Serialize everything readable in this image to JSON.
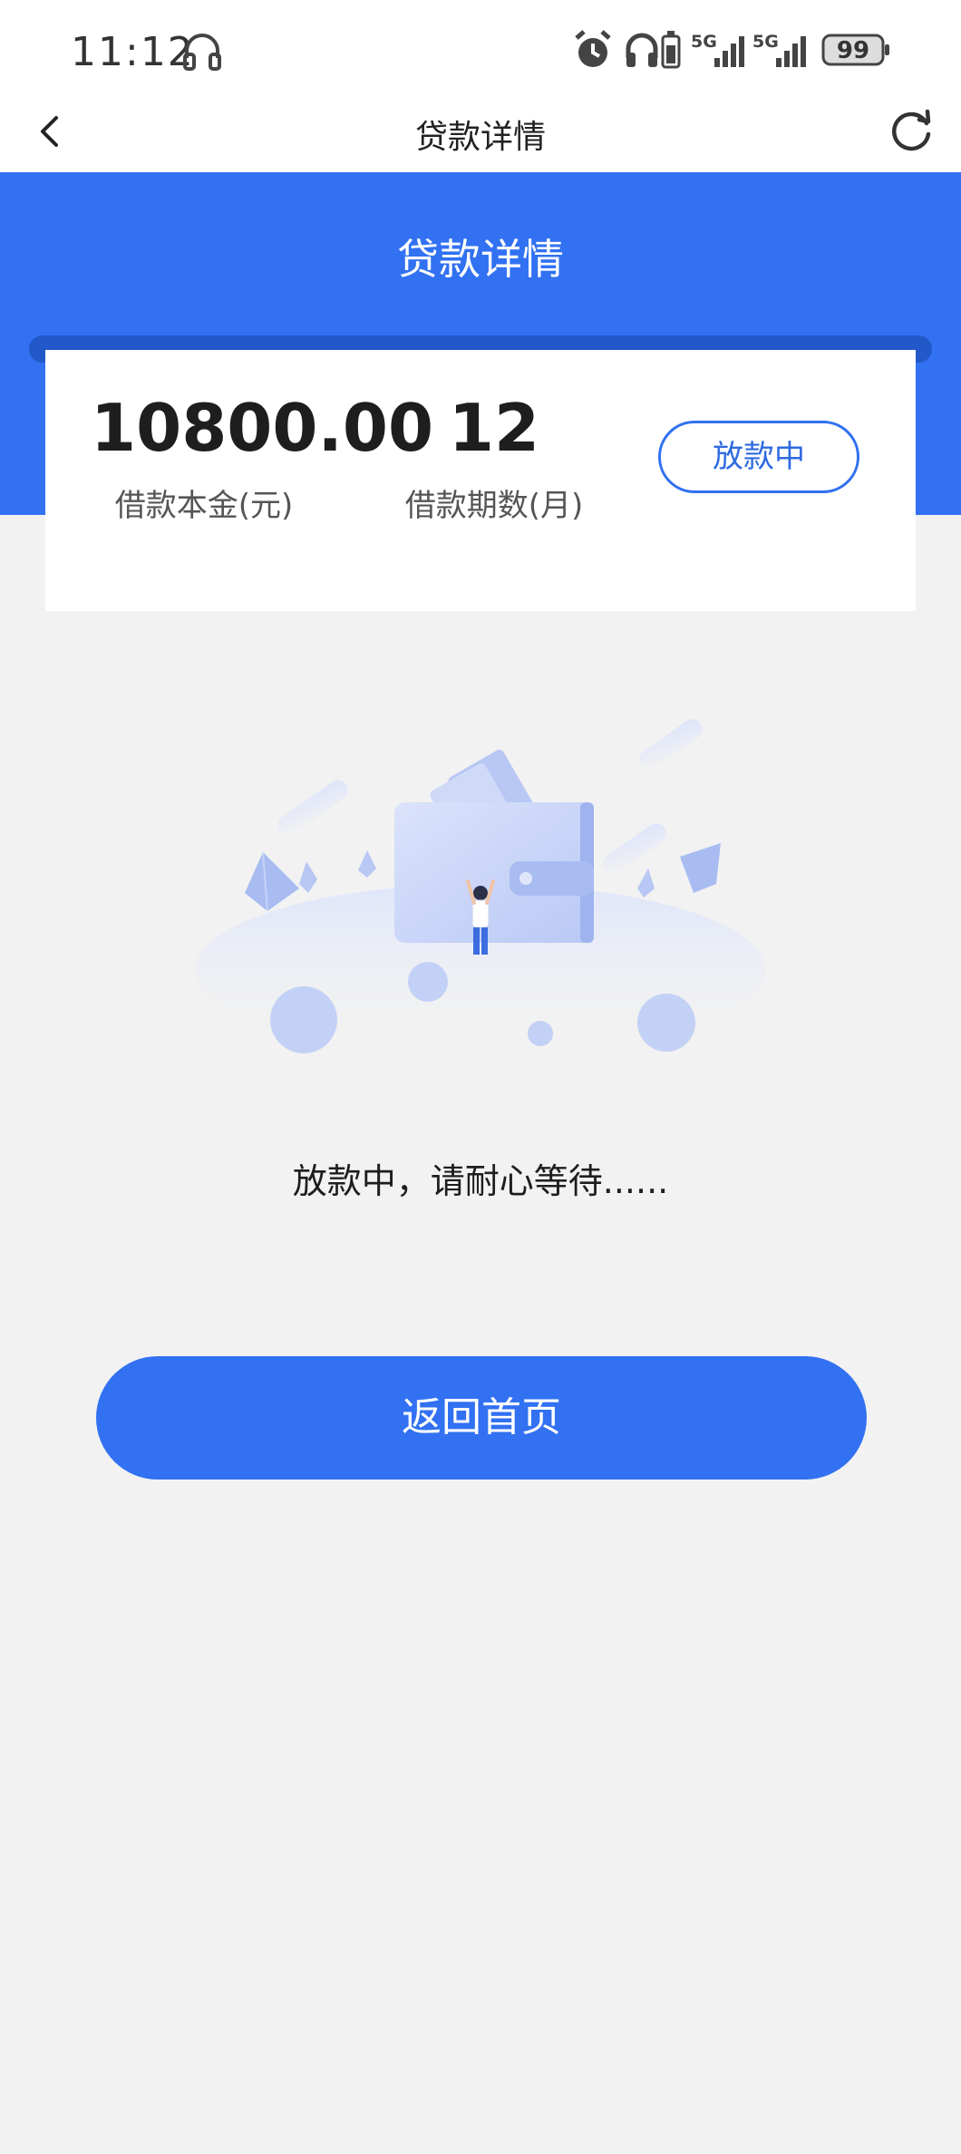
{
  "status_bar": {
    "time": "11:12",
    "signal_1": "5G",
    "signal_2": "5G",
    "battery": "99"
  },
  "navbar": {
    "title": "贷款详情",
    "back_icon": "chevron-left-icon",
    "refresh_icon": "refresh-icon"
  },
  "hero": {
    "title": "贷款详情"
  },
  "loan": {
    "amount_value": "10800.00",
    "amount_label": "借款本金(元)",
    "term_value": "12",
    "term_label": "借款期数(月)",
    "status": "放款中"
  },
  "illustration": {
    "icon": "wallet-waiting-illustration"
  },
  "message": "放款中，请耐心等待......",
  "home_button": "返回首页",
  "colors": {
    "primary": "#3171f2",
    "slot": "#2358c8",
    "background": "#f2f2f2",
    "card": "#ffffff"
  }
}
